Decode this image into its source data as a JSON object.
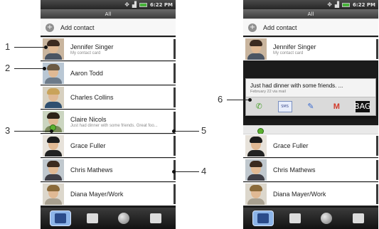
{
  "left_screen": {
    "status_time": "6:22 PM",
    "title": "All",
    "add_contact_label": "Add contact",
    "contacts": [
      {
        "name": "Jennifer Singer",
        "sub": "My contact card"
      },
      {
        "name": "Aaron Todd",
        "sub": ""
      },
      {
        "name": "Charles Collins",
        "sub": ""
      },
      {
        "name": "Claire Nicols",
        "sub": "Just had dinner with some friends. Great foo..."
      },
      {
        "name": "Grace Fuller",
        "sub": ""
      },
      {
        "name": "Chris Mathews",
        "sub": ""
      },
      {
        "name": "Diana Mayer/Work",
        "sub": ""
      }
    ]
  },
  "right_screen": {
    "status_time": "6:22 PM",
    "title": "All",
    "add_contact_label": "Add contact",
    "popup": {
      "message": "Just had dinner with some friends. ...",
      "time": "February 22 via mail",
      "actions": [
        "call-icon",
        "sms-icon",
        "im-icon",
        "gmail-icon",
        "app-icon"
      ],
      "sms_label": "SMS",
      "gmail_label": "M",
      "app_label": "BAG"
    },
    "contacts": [
      {
        "name": "Jennifer Singer",
        "sub": "My contact card"
      },
      {
        "name": "Grace Fuller",
        "sub": ""
      },
      {
        "name": "Chris Mathews",
        "sub": ""
      },
      {
        "name": "Diana Mayer/Work",
        "sub": ""
      }
    ]
  },
  "callouts": {
    "c1": "1",
    "c2": "2",
    "c3": "3",
    "c4": "4",
    "c5": "5",
    "c6": "6"
  },
  "colors": {
    "presence": "#5cb130",
    "active_tab": "#8cb4e8"
  }
}
